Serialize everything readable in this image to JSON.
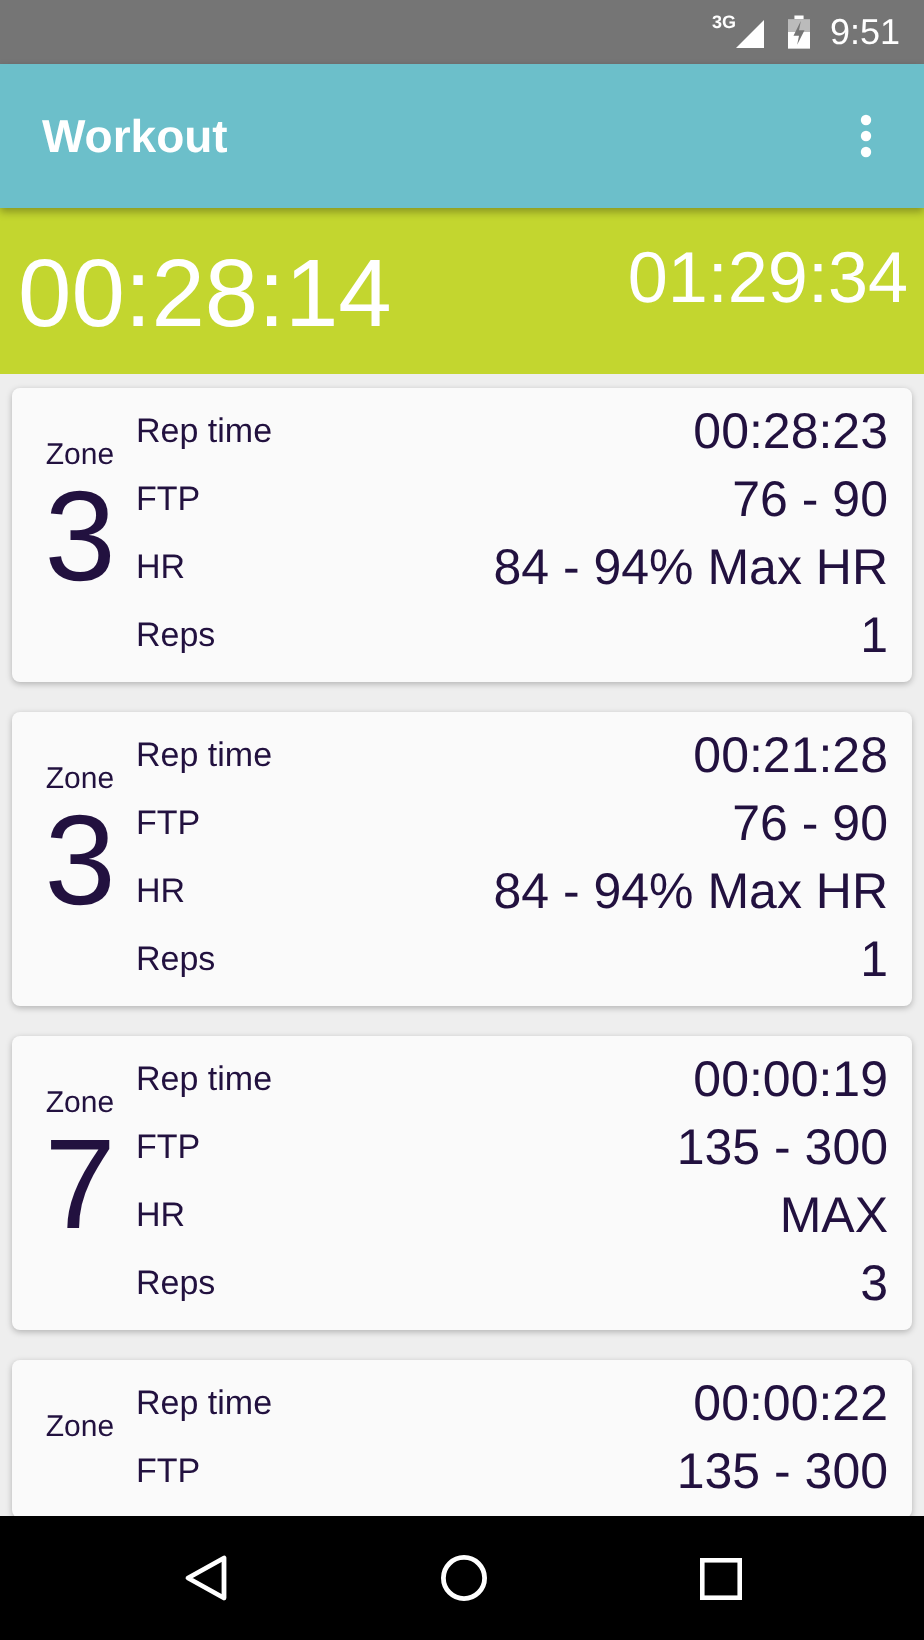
{
  "status_bar": {
    "network": "3G",
    "time": "9:51"
  },
  "app_bar": {
    "title": "Workout"
  },
  "timers": {
    "elapsed": "00:28:14",
    "total": "01:29:34"
  },
  "intervals": [
    {
      "zone_label": "Zone",
      "zone": "3",
      "rows": [
        {
          "label": "Rep time",
          "value": "00:28:23"
        },
        {
          "label": "FTP",
          "value": "76 - 90"
        },
        {
          "label": "HR",
          "value": "84 - 94% Max HR"
        },
        {
          "label": "Reps",
          "value": "1"
        }
      ]
    },
    {
      "zone_label": "Zone",
      "zone": "3",
      "rows": [
        {
          "label": "Rep time",
          "value": "00:21:28"
        },
        {
          "label": "FTP",
          "value": "76 - 90"
        },
        {
          "label": "HR",
          "value": "84 - 94% Max HR"
        },
        {
          "label": "Reps",
          "value": "1"
        }
      ]
    },
    {
      "zone_label": "Zone",
      "zone": "7",
      "rows": [
        {
          "label": "Rep time",
          "value": "00:00:19"
        },
        {
          "label": "FTP",
          "value": "135 - 300"
        },
        {
          "label": "HR",
          "value": "MAX"
        },
        {
          "label": "Reps",
          "value": "3"
        }
      ]
    },
    {
      "zone_label": "Zone",
      "rows": [
        {
          "label": "Rep time",
          "value": "00:00:22"
        },
        {
          "label": "FTP",
          "value": "135 - 300"
        }
      ]
    }
  ]
}
